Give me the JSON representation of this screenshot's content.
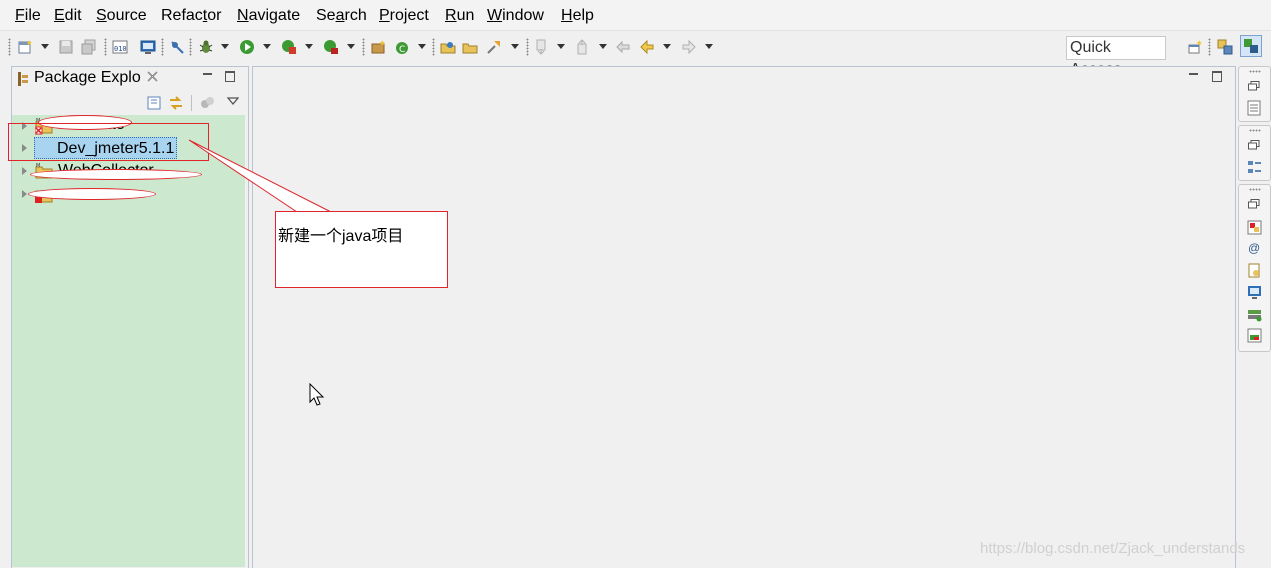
{
  "menu": {
    "file": {
      "mnemonic": "F",
      "rest": "ile"
    },
    "edit": {
      "mnemonic": "E",
      "rest": "dit"
    },
    "source": {
      "mnemonic": "S",
      "rest": "ource"
    },
    "refactor": {
      "pre": "Refac",
      "mnemonic": "t",
      "rest": "or"
    },
    "navigate": {
      "mnemonic": "N",
      "rest": "avigate"
    },
    "search": {
      "pre": "Se",
      "mnemonic": "a",
      "rest": "rch"
    },
    "project": {
      "mnemonic": "P",
      "rest": "roject"
    },
    "run": {
      "mnemonic": "R",
      "rest": "un"
    },
    "window": {
      "mnemonic": "W",
      "rest": "indow"
    },
    "help": {
      "mnemonic": "H",
      "rest": "elp"
    }
  },
  "toolbar": {
    "quick_access_label": "Quick Access"
  },
  "package_explorer": {
    "tab_label": "Package Explo",
    "projects": [
      {
        "label": "Calculate",
        "redacted": true
      },
      {
        "label": "Dev_jmeter5.1.1",
        "selected": true
      },
      {
        "label": "WebCollector",
        "redacted": true
      },
      {
        "label": "",
        "redacted": true
      }
    ]
  },
  "annotation": {
    "callout_text": "新建一个java项目",
    "color": "#e0242a"
  },
  "watermark": "https://blog.csdn.net/Zjack_understands",
  "colors": {
    "tree_background": "#cce8cf",
    "selection": "#a8d4f0",
    "annotation": "#e0242a"
  }
}
